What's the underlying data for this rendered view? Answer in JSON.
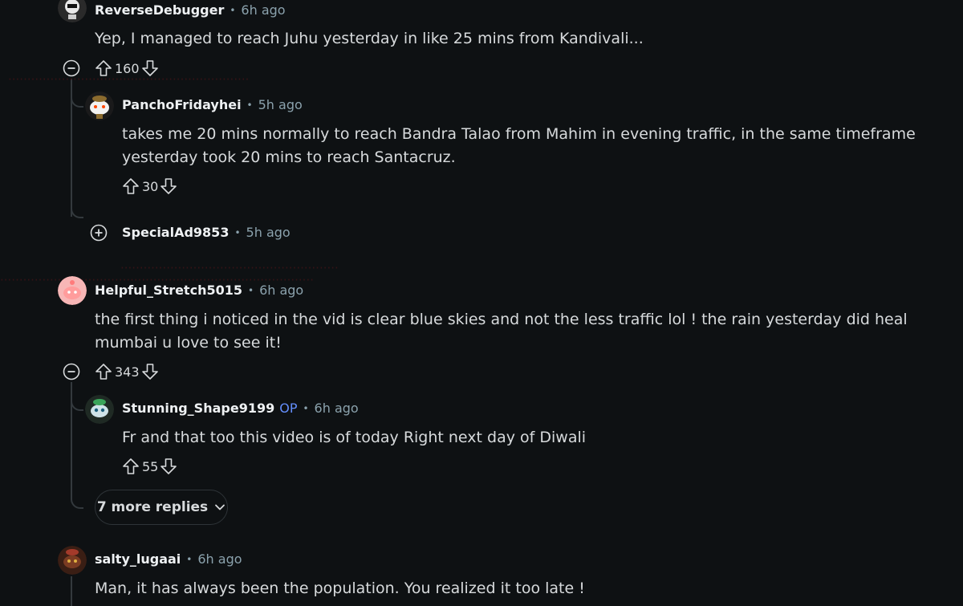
{
  "comments": [
    {
      "user": "ReverseDebugger",
      "time": "6h ago",
      "text": "Yep, I managed to reach Juhu yesterday in like 25 mins from Kandivali...",
      "score": "160",
      "icon": "avatar-robot"
    },
    {
      "user": "PanchoFridayhei",
      "time": "5h ago",
      "text": "takes me 20 mins normally to reach Bandra Talao from Mahim in evening traffic, in the same timeframe yesterday took 20 mins to reach Santacruz.",
      "score": "30",
      "icon": "avatar-snoo"
    },
    {
      "user": "SpecialAd9853",
      "time": "5h ago",
      "icon": "plus-circle-icon"
    },
    {
      "user": "Helpful_Stretch5015",
      "time": "6h ago",
      "text": "the first thing i noticed in the vid is clear blue skies and not the less traffic lol ! the rain yesterday did heal mumbai u love to see it!",
      "score": "343",
      "icon": "avatar-pink-snoo"
    },
    {
      "user": "Stunning_Shape9199",
      "op": "OP",
      "time": "6h ago",
      "text": "Fr and that too this video is of today Right next day of Diwali",
      "score": "55",
      "icon": "avatar-green-snoo"
    },
    {
      "user": "salty_lugaai",
      "time": "6h ago",
      "text": "Man, it has always been the population. You realized it too late !",
      "icon": "avatar-red-snoo"
    }
  ],
  "more_replies": "7 more replies",
  "colors": {
    "background": "#0e1113",
    "op": "#648efc",
    "meta": "#8ba2ad",
    "line": "#33393d"
  }
}
